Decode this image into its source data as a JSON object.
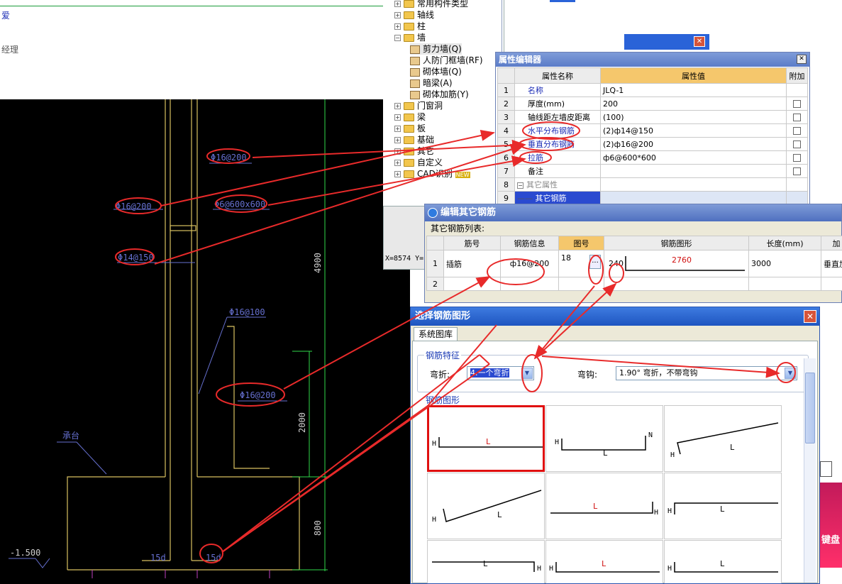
{
  "cad": {
    "top_text_1": "爱",
    "top_text_2": "经理",
    "labels": {
      "l1": "Φ16@200",
      "l2": "Φ16@200",
      "l3": "Φ6@600x600",
      "l4": "Φ14@150",
      "l5": "Φ16@100",
      "l6": "Φ16@200",
      "l7": "承台",
      "dim_4900": "4900",
      "dim_2000": "2000",
      "dim_800": "800",
      "elev": "-1.500",
      "d1": "15d",
      "d2": "15d"
    }
  },
  "tree": {
    "items": [
      {
        "label": "常用构件类型",
        "kind": "folder"
      },
      {
        "label": "轴线",
        "kind": "folder"
      },
      {
        "label": "柱",
        "kind": "folder"
      },
      {
        "label": "墙",
        "kind": "folder-open"
      },
      {
        "label": "剪力墙(Q)",
        "kind": "leaf"
      },
      {
        "label": "人防门框墙(RF)",
        "kind": "leaf"
      },
      {
        "label": "砌体墙(Q)",
        "kind": "leaf"
      },
      {
        "label": "暗梁(A)",
        "kind": "leaf"
      },
      {
        "label": "砌体加筋(Y)",
        "kind": "leaf"
      },
      {
        "label": "门窗洞",
        "kind": "folder"
      },
      {
        "label": "梁",
        "kind": "folder"
      },
      {
        "label": "板",
        "kind": "folder"
      },
      {
        "label": "基础",
        "kind": "folder"
      },
      {
        "label": "其它",
        "kind": "folder"
      },
      {
        "label": "自定义",
        "kind": "folder"
      },
      {
        "label": "CAD识别",
        "kind": "folder"
      }
    ],
    "new_badge": "NEW"
  },
  "status": {
    "coords": "X=8574 Y="
  },
  "prop_editor": {
    "title": "属性编辑器",
    "col_name": "属性名称",
    "col_value": "属性值",
    "col_extra": "附加",
    "rows": [
      {
        "n": "1",
        "name": "名称",
        "value": "JLQ-1",
        "blue": true
      },
      {
        "n": "2",
        "name": "厚度(mm)",
        "value": "200",
        "blue": false
      },
      {
        "n": "3",
        "name": "轴线距左墙皮距离",
        "value": "(100)",
        "blue": false
      },
      {
        "n": "4",
        "name": "水平分布钢筋",
        "value": "(2)ф14@150",
        "blue": true
      },
      {
        "n": "5",
        "name": "垂直分布钢筋",
        "value": "(2)ф16@200",
        "blue": true
      },
      {
        "n": "6",
        "name": "拉筋",
        "value": "ф6@600*600",
        "blue": true
      },
      {
        "n": "7",
        "name": "备注",
        "value": "",
        "blue": false
      },
      {
        "n": "8",
        "name": "其它属性",
        "value": "",
        "blue": false
      },
      {
        "n": "9",
        "name": "其它钢筋",
        "value": "",
        "blue": false
      }
    ]
  },
  "edit_rebar": {
    "title": "编辑其它钢筋",
    "list_label": "其它钢筋列表:",
    "headers": [
      "筋号",
      "钢筋信息",
      "图号",
      "钢筋图形",
      "长度(mm)",
      "加"
    ],
    "row1": {
      "n": "1",
      "name": "插筋",
      "info": "ф16@200",
      "fig": "18",
      "btn": "...",
      "len_left": "240",
      "len_main": "2760",
      "length": "3000",
      "extra": "垂直加"
    },
    "row2": {
      "n": "2"
    }
  },
  "select_shape": {
    "title": "选择钢筋图形",
    "tab": "系统图库",
    "feature_label": "钢筋特征",
    "bend_label": "弯折:",
    "bend_value": "4.一个弯折",
    "hook_label": "弯钩:",
    "hook_value": "1.90° 弯折，不带弯钩",
    "shape_label": "钢筋图形",
    "shapes": [
      {
        "h": "H",
        "l": "L"
      },
      {
        "h": "H",
        "l": "L",
        "n": "N"
      },
      {
        "h": "H",
        "l": "L"
      },
      {
        "h": "H",
        "l": "L"
      },
      {
        "h": "H",
        "l": "L"
      },
      {
        "h": "H",
        "l": "L"
      },
      {
        "h": "H",
        "l": "L"
      },
      {
        "h": "H",
        "l": "L"
      },
      {
        "h": "H",
        "l": "L"
      }
    ]
  },
  "ad": {
    "text": "键盘"
  },
  "colors": {
    "annotation_red": "#e82a2a",
    "cad_blue": "#6670d0",
    "cad_yellow": "#d8c060"
  }
}
